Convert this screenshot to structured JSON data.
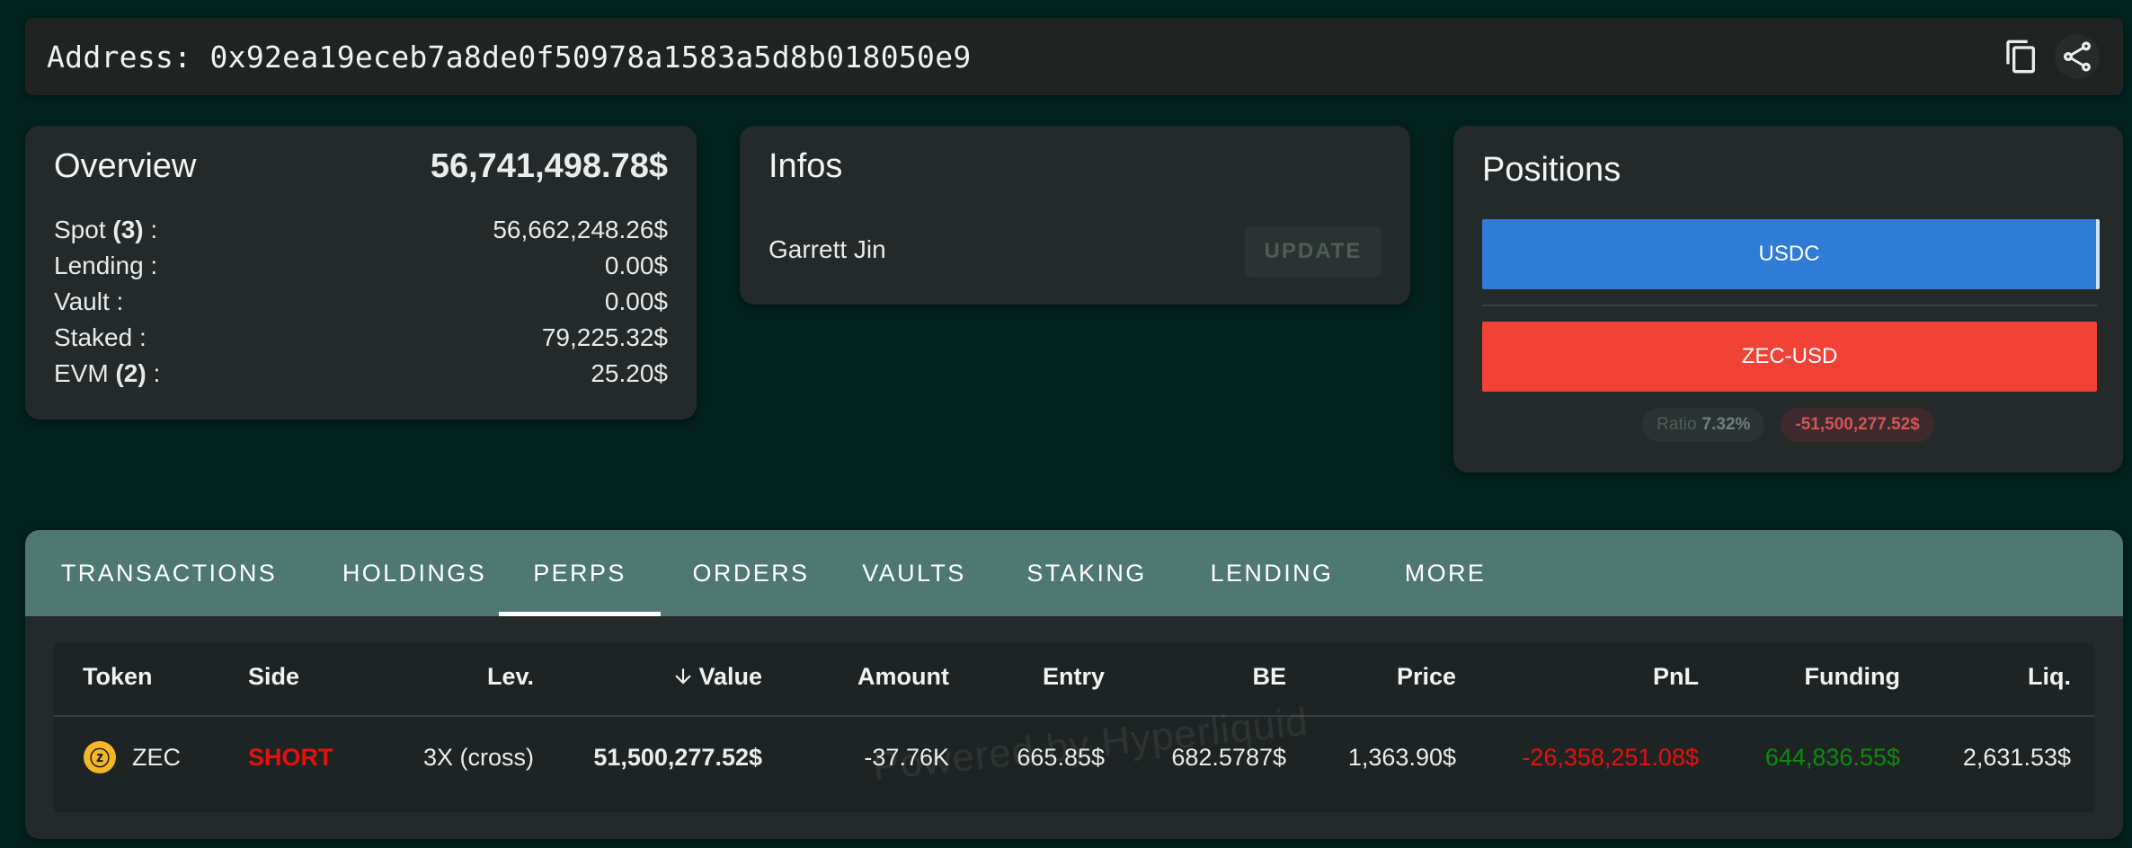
{
  "address_bar": {
    "label": "Address:",
    "value": "0x92ea19eceb7a8de0f50978a1583a5d8b018050e9",
    "icons": [
      "copy-icon",
      "share-icon"
    ]
  },
  "overview": {
    "title": "Overview",
    "total": "56,741,498.78$",
    "rows": [
      {
        "label": "Spot ",
        "count": "(3)",
        "suffix": " :",
        "value": "56,662,248.26$"
      },
      {
        "label": "Lending :",
        "count": "",
        "suffix": "",
        "value": "0.00$"
      },
      {
        "label": "Vault :",
        "count": "",
        "suffix": "",
        "value": "0.00$"
      },
      {
        "label": "Staked :",
        "count": "",
        "suffix": "",
        "value": "79,225.32$"
      },
      {
        "label": "EVM ",
        "count": "(2)",
        "suffix": " :",
        "value": "25.20$"
      }
    ]
  },
  "infos": {
    "title": "Infos",
    "name": "Garrett Jin",
    "update_label": "UPDATE"
  },
  "positions": {
    "title": "Positions",
    "long_label": "USDC",
    "short_label": "ZEC-USD",
    "ratio_label": "Ratio",
    "ratio_value": "7.32%",
    "net_value": "-51,500,277.52$",
    "colors": {
      "long": "#2f7bd6",
      "short": "#f24236"
    }
  },
  "tabs": [
    {
      "label": "TRANSACTIONS"
    },
    {
      "label": "HOLDINGS"
    },
    {
      "label": "PERPS"
    },
    {
      "label": "ORDERS"
    },
    {
      "label": "VAULTS"
    },
    {
      "label": "STAKING"
    },
    {
      "label": "LENDING"
    },
    {
      "label": "MORE"
    }
  ],
  "active_tab": "PERPS",
  "table": {
    "sort_icon": "arrow-down-icon",
    "headers": [
      "Token",
      "Side",
      "Lev.",
      "Value",
      "Amount",
      "Entry",
      "BE",
      "Price",
      "PnL",
      "Funding",
      "Liq."
    ],
    "watermark": "Powered by Hyperliquid",
    "rows": [
      {
        "token": "ZEC",
        "token_icon": "zec-logo-icon",
        "side": "SHORT",
        "lev": "3X (cross)",
        "value": "51,500,277.52$",
        "amount": "-37.76K",
        "entry": "665.85$",
        "be": "682.5787$",
        "price": "1,363.90$",
        "pnl": "-26,358,251.08$",
        "funding": "644,836.55$",
        "liq": "2,631.53$"
      }
    ],
    "colors": {
      "short": "#e3120b",
      "pnl_negative": "#e3120b",
      "funding_positive": "#0e8a0e"
    }
  }
}
